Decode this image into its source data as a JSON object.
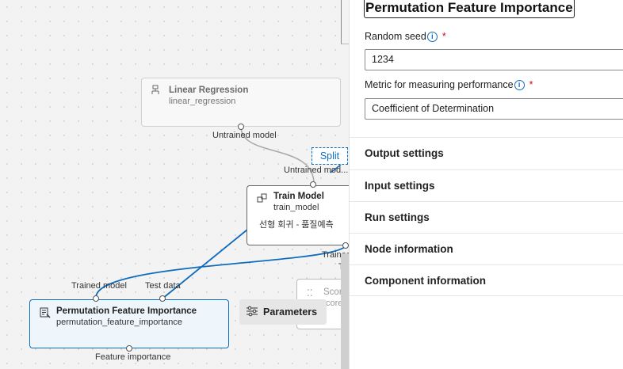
{
  "canvas": {
    "linear_regression": {
      "title": "Linear Regression",
      "subtitle": "linear_regression",
      "output_port": "Untrained model",
      "icon": "linear-regression-icon"
    },
    "split_button": "Split",
    "train_model": {
      "title": "Train Model",
      "subtitle": "train_model",
      "comment": "선형 회귀 - 품질예측",
      "input_port": "Untrained mod...",
      "output_port": "Trained",
      "output_port_2": "Tra",
      "icon": "train-model-icon"
    },
    "permutation": {
      "title": "Permutation Feature Importance",
      "subtitle": "permutation_feature_importance",
      "input_port_1": "Trained model",
      "input_port_2": "Test data",
      "output_port": "Feature importance",
      "icon": "permutation-icon"
    },
    "score_model": {
      "title": "Scor",
      "subtitle": "core",
      "icon": "score-model-icon"
    },
    "parameters_button": "Parameters",
    "edge_color": "#0f6cbd"
  },
  "panel": {
    "title": "Permutation Feature Importance",
    "random_seed": {
      "label": "Random seed",
      "required_mark": "*",
      "value": "1234"
    },
    "metric": {
      "label": "Metric for measuring performance",
      "required_mark": "*",
      "value": "Coefficient of Determination"
    },
    "sections": [
      "Output settings",
      "Input settings",
      "Run settings",
      "Node information",
      "Component information"
    ]
  }
}
